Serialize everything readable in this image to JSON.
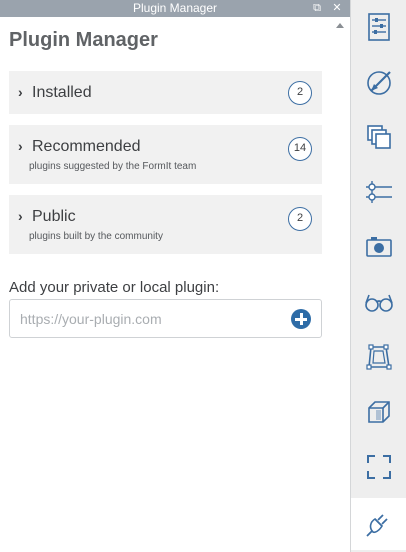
{
  "window": {
    "title": "Plugin Manager",
    "restore_glyph": "⧉",
    "close_glyph": "✕"
  },
  "panel": {
    "title": "Plugin Manager",
    "sections": [
      {
        "name": "Installed",
        "subtitle": "",
        "count": "2"
      },
      {
        "name": "Recommended",
        "subtitle": "plugins suggested by the FormIt team",
        "count": "14"
      },
      {
        "name": "Public",
        "subtitle": "plugins built by the community",
        "count": "2"
      }
    ],
    "add_label": "Add your private or local plugin:",
    "url_placeholder": "https://your-plugin.com"
  },
  "toolbar": {
    "items": [
      {
        "icon": "properties-icon"
      },
      {
        "icon": "materials-icon"
      },
      {
        "icon": "layers-icon"
      },
      {
        "icon": "levels-icon"
      },
      {
        "icon": "scenes-icon"
      },
      {
        "icon": "visual-styles-icon"
      },
      {
        "icon": "groups-icon"
      },
      {
        "icon": "components-icon"
      },
      {
        "icon": "fit-view-icon"
      },
      {
        "icon": "plugin-icon",
        "active": true
      }
    ]
  },
  "colors": {
    "accent": "#2e6ca7",
    "icon": "#3c6ea3",
    "titlebar": "#9aa3ad",
    "card": "#f1f1f1"
  }
}
